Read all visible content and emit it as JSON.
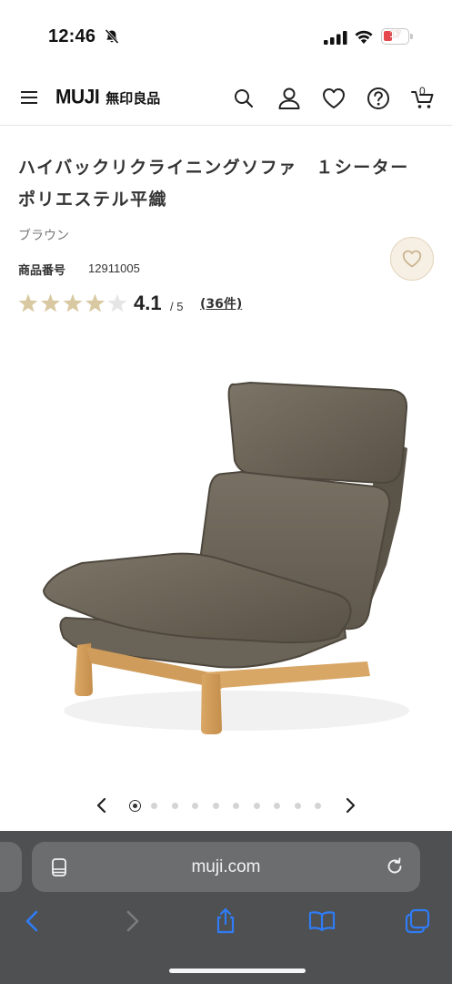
{
  "status_bar": {
    "time": "12:46",
    "battery_level": "17",
    "icons": [
      "bell-slash-icon",
      "cellular-signal-icon",
      "wifi-icon",
      "battery-icon"
    ]
  },
  "header": {
    "logo_en": "MUJI",
    "logo_jp": "無印良品",
    "cart_count": "0",
    "icons": [
      "menu-icon",
      "search-icon",
      "account-icon",
      "favorite-icon",
      "help-icon",
      "cart-icon"
    ]
  },
  "product": {
    "title": "ハイバックリクライニングソファ　１シーター　ポリエステル平織",
    "color": "ブラウン",
    "number_label": "商品番号",
    "number": "12911005",
    "rating": {
      "stars_filled": 4,
      "stars_total": 5,
      "value": "4.1",
      "max": "/ 5",
      "count": "(36件)"
    }
  },
  "carousel": {
    "total_slides": 10,
    "active_index": 0
  },
  "browser": {
    "url": "muji.com",
    "toolbar": [
      "back-icon",
      "forward-icon",
      "share-icon",
      "bookmarks-icon",
      "tabs-icon"
    ]
  },
  "colors": {
    "accent_fav_bg": "#f6efe4",
    "star_filled": "#d9c9a3",
    "star_empty": "#e6e6e6",
    "safari_bar": "#4e5051",
    "ios_blue": "#2f7cf6"
  }
}
